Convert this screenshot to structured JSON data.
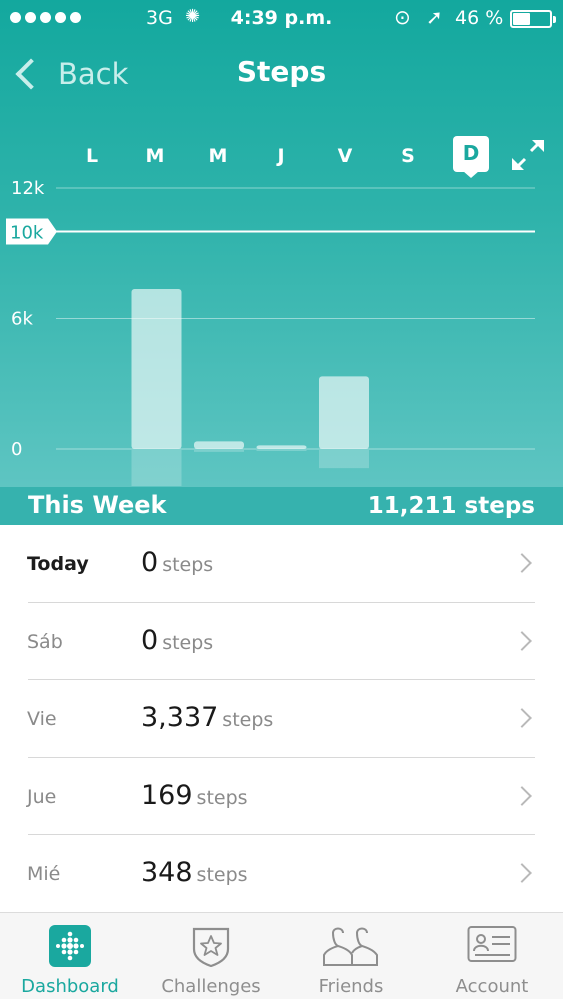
{
  "status_bar": {
    "network": "3G",
    "time": "4:39 p.m.",
    "battery": "46 %",
    "battery_level": 0.46
  },
  "nav": {
    "back_label": "Back",
    "title": "Steps"
  },
  "day_tabs": [
    "L",
    "M",
    "M",
    "J",
    "V",
    "S",
    "D"
  ],
  "active_day_index": 6,
  "chart_data": {
    "type": "bar",
    "categories": [
      "L",
      "M",
      "M",
      "J",
      "V",
      "S",
      "D"
    ],
    "values": [
      0,
      7357,
      348,
      169,
      3337,
      0,
      0
    ],
    "ylim": [
      0,
      12000
    ],
    "y_ticks": [
      {
        "value": 12000,
        "label": "12k"
      },
      {
        "value": 6000,
        "label": "6k"
      },
      {
        "value": 0,
        "label": "0"
      }
    ],
    "goal": {
      "value": 10000,
      "label": "10k"
    },
    "grid": true
  },
  "week_summary": {
    "label": "This Week",
    "total": "11,211 steps"
  },
  "days": [
    {
      "name": "Today",
      "value": "0",
      "unit": "steps"
    },
    {
      "name": "Sáb",
      "value": "0",
      "unit": "steps"
    },
    {
      "name": "Vie",
      "value": "3,337",
      "unit": "steps"
    },
    {
      "name": "Jue",
      "value": "169",
      "unit": "steps"
    },
    {
      "name": "Mié",
      "value": "348",
      "unit": "steps"
    }
  ],
  "tabs": [
    {
      "label": "Dashboard",
      "icon": "dashboard-icon"
    },
    {
      "label": "Challenges",
      "icon": "challenges-star-icon"
    },
    {
      "label": "Friends",
      "icon": "friends-icon"
    },
    {
      "label": "Account",
      "icon": "account-card-icon"
    }
  ],
  "colors": {
    "accent": "#1aa89f",
    "header_top": "#13a89e",
    "header_bottom": "#5ec5c2",
    "week_bar": "#36b2ae"
  }
}
